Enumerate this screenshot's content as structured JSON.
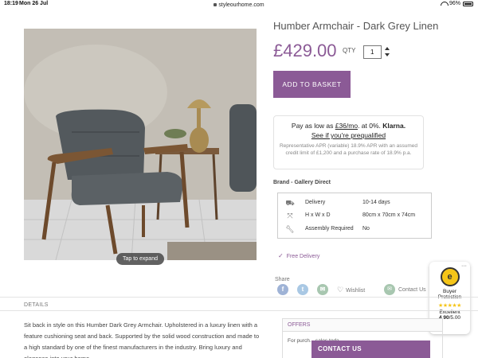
{
  "status_bar": {
    "time": "18:19",
    "date": "Mon 26 Jul",
    "url": "styleourhome.com",
    "battery": "96%"
  },
  "product": {
    "title": "Humber Armchair - Dark Grey Linen",
    "price": "£429.00",
    "qty_label": "QTY",
    "qty_value": "1",
    "add_to_basket": "ADD TO BASKET",
    "tap_to_expand": "Tap to expand"
  },
  "klarna": {
    "line1_prefix": "Pay as low as ",
    "line1_amount": "£36/mo",
    "line1_mid": ". at 0%. ",
    "line1_brand": "Klarna.",
    "line2": "See if you're prequalified",
    "line3": "Representative APR (variable) 18.9% APR with an assumed credit limit of £1,200 and a purchase rate of 18.9% p.a."
  },
  "brand": "Brand - Gallery Direct",
  "specs": [
    {
      "icon": "truck-icon",
      "key": "Delivery",
      "value": "10-14 days"
    },
    {
      "icon": "dimensions-icon",
      "key": "H x W x D",
      "value": "80cm x 70cm x 74cm"
    },
    {
      "icon": "wrench-icon",
      "key": "Assembly Required",
      "value": "No"
    }
  ],
  "free_delivery": "Free Delivery",
  "share": {
    "label": "Share",
    "wishlist": "Wishlist",
    "contact_us": "Contact Us"
  },
  "trust_badge": {
    "title_line1": "Buyer",
    "title_line2": "Protection",
    "rating_label": "Excellent",
    "score": "4.90",
    "score_suffix": "/5.00"
  },
  "details": {
    "label": "DETAILS",
    "description": "Sit back in style on this Humber Dark Grey Armchair. Upholstered in a luxury linen with a feature cushioning seat and back. Supported by the solid wood construction and made to a high standard by one of the finest manufacturers in the industry. Bring luxury and elegance into your home."
  },
  "offers": {
    "label": "OFFERS",
    "text": "For purch... sales toda..."
  },
  "contact_bar": "CONTACT US",
  "colors": {
    "accent": "#8b5a96",
    "star": "#f5c518"
  }
}
